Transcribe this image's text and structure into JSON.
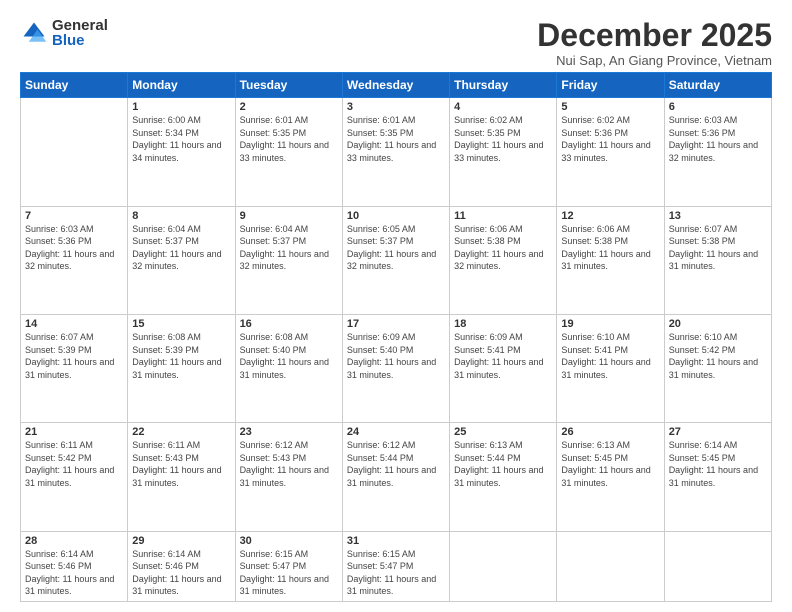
{
  "logo": {
    "general": "General",
    "blue": "Blue"
  },
  "title": "December 2025",
  "location": "Nui Sap, An Giang Province, Vietnam",
  "days": [
    "Sunday",
    "Monday",
    "Tuesday",
    "Wednesday",
    "Thursday",
    "Friday",
    "Saturday"
  ],
  "weeks": [
    [
      {
        "num": "",
        "sunrise": "",
        "sunset": "",
        "daylight": ""
      },
      {
        "num": "1",
        "sunrise": "Sunrise: 6:00 AM",
        "sunset": "Sunset: 5:34 PM",
        "daylight": "Daylight: 11 hours and 34 minutes."
      },
      {
        "num": "2",
        "sunrise": "Sunrise: 6:01 AM",
        "sunset": "Sunset: 5:35 PM",
        "daylight": "Daylight: 11 hours and 33 minutes."
      },
      {
        "num": "3",
        "sunrise": "Sunrise: 6:01 AM",
        "sunset": "Sunset: 5:35 PM",
        "daylight": "Daylight: 11 hours and 33 minutes."
      },
      {
        "num": "4",
        "sunrise": "Sunrise: 6:02 AM",
        "sunset": "Sunset: 5:35 PM",
        "daylight": "Daylight: 11 hours and 33 minutes."
      },
      {
        "num": "5",
        "sunrise": "Sunrise: 6:02 AM",
        "sunset": "Sunset: 5:36 PM",
        "daylight": "Daylight: 11 hours and 33 minutes."
      },
      {
        "num": "6",
        "sunrise": "Sunrise: 6:03 AM",
        "sunset": "Sunset: 5:36 PM",
        "daylight": "Daylight: 11 hours and 32 minutes."
      }
    ],
    [
      {
        "num": "7",
        "sunrise": "Sunrise: 6:03 AM",
        "sunset": "Sunset: 5:36 PM",
        "daylight": "Daylight: 11 hours and 32 minutes."
      },
      {
        "num": "8",
        "sunrise": "Sunrise: 6:04 AM",
        "sunset": "Sunset: 5:37 PM",
        "daylight": "Daylight: 11 hours and 32 minutes."
      },
      {
        "num": "9",
        "sunrise": "Sunrise: 6:04 AM",
        "sunset": "Sunset: 5:37 PM",
        "daylight": "Daylight: 11 hours and 32 minutes."
      },
      {
        "num": "10",
        "sunrise": "Sunrise: 6:05 AM",
        "sunset": "Sunset: 5:37 PM",
        "daylight": "Daylight: 11 hours and 32 minutes."
      },
      {
        "num": "11",
        "sunrise": "Sunrise: 6:06 AM",
        "sunset": "Sunset: 5:38 PM",
        "daylight": "Daylight: 11 hours and 32 minutes."
      },
      {
        "num": "12",
        "sunrise": "Sunrise: 6:06 AM",
        "sunset": "Sunset: 5:38 PM",
        "daylight": "Daylight: 11 hours and 31 minutes."
      },
      {
        "num": "13",
        "sunrise": "Sunrise: 6:07 AM",
        "sunset": "Sunset: 5:38 PM",
        "daylight": "Daylight: 11 hours and 31 minutes."
      }
    ],
    [
      {
        "num": "14",
        "sunrise": "Sunrise: 6:07 AM",
        "sunset": "Sunset: 5:39 PM",
        "daylight": "Daylight: 11 hours and 31 minutes."
      },
      {
        "num": "15",
        "sunrise": "Sunrise: 6:08 AM",
        "sunset": "Sunset: 5:39 PM",
        "daylight": "Daylight: 11 hours and 31 minutes."
      },
      {
        "num": "16",
        "sunrise": "Sunrise: 6:08 AM",
        "sunset": "Sunset: 5:40 PM",
        "daylight": "Daylight: 11 hours and 31 minutes."
      },
      {
        "num": "17",
        "sunrise": "Sunrise: 6:09 AM",
        "sunset": "Sunset: 5:40 PM",
        "daylight": "Daylight: 11 hours and 31 minutes."
      },
      {
        "num": "18",
        "sunrise": "Sunrise: 6:09 AM",
        "sunset": "Sunset: 5:41 PM",
        "daylight": "Daylight: 11 hours and 31 minutes."
      },
      {
        "num": "19",
        "sunrise": "Sunrise: 6:10 AM",
        "sunset": "Sunset: 5:41 PM",
        "daylight": "Daylight: 11 hours and 31 minutes."
      },
      {
        "num": "20",
        "sunrise": "Sunrise: 6:10 AM",
        "sunset": "Sunset: 5:42 PM",
        "daylight": "Daylight: 11 hours and 31 minutes."
      }
    ],
    [
      {
        "num": "21",
        "sunrise": "Sunrise: 6:11 AM",
        "sunset": "Sunset: 5:42 PM",
        "daylight": "Daylight: 11 hours and 31 minutes."
      },
      {
        "num": "22",
        "sunrise": "Sunrise: 6:11 AM",
        "sunset": "Sunset: 5:43 PM",
        "daylight": "Daylight: 11 hours and 31 minutes."
      },
      {
        "num": "23",
        "sunrise": "Sunrise: 6:12 AM",
        "sunset": "Sunset: 5:43 PM",
        "daylight": "Daylight: 11 hours and 31 minutes."
      },
      {
        "num": "24",
        "sunrise": "Sunrise: 6:12 AM",
        "sunset": "Sunset: 5:44 PM",
        "daylight": "Daylight: 11 hours and 31 minutes."
      },
      {
        "num": "25",
        "sunrise": "Sunrise: 6:13 AM",
        "sunset": "Sunset: 5:44 PM",
        "daylight": "Daylight: 11 hours and 31 minutes."
      },
      {
        "num": "26",
        "sunrise": "Sunrise: 6:13 AM",
        "sunset": "Sunset: 5:45 PM",
        "daylight": "Daylight: 11 hours and 31 minutes."
      },
      {
        "num": "27",
        "sunrise": "Sunrise: 6:14 AM",
        "sunset": "Sunset: 5:45 PM",
        "daylight": "Daylight: 11 hours and 31 minutes."
      }
    ],
    [
      {
        "num": "28",
        "sunrise": "Sunrise: 6:14 AM",
        "sunset": "Sunset: 5:46 PM",
        "daylight": "Daylight: 11 hours and 31 minutes."
      },
      {
        "num": "29",
        "sunrise": "Sunrise: 6:14 AM",
        "sunset": "Sunset: 5:46 PM",
        "daylight": "Daylight: 11 hours and 31 minutes."
      },
      {
        "num": "30",
        "sunrise": "Sunrise: 6:15 AM",
        "sunset": "Sunset: 5:47 PM",
        "daylight": "Daylight: 11 hours and 31 minutes."
      },
      {
        "num": "31",
        "sunrise": "Sunrise: 6:15 AM",
        "sunset": "Sunset: 5:47 PM",
        "daylight": "Daylight: 11 hours and 31 minutes."
      },
      {
        "num": "",
        "sunrise": "",
        "sunset": "",
        "daylight": ""
      },
      {
        "num": "",
        "sunrise": "",
        "sunset": "",
        "daylight": ""
      },
      {
        "num": "",
        "sunrise": "",
        "sunset": "",
        "daylight": ""
      }
    ]
  ]
}
